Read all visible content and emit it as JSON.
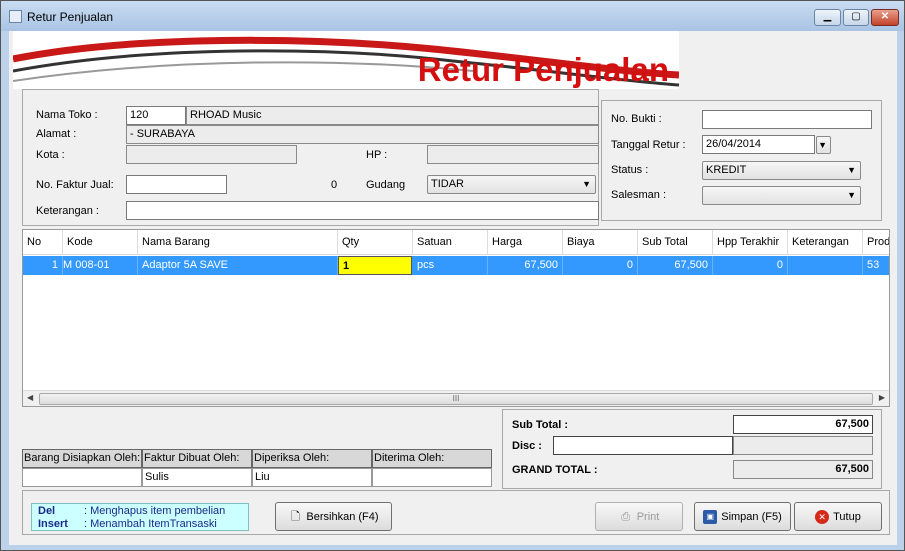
{
  "window": {
    "title": "Retur Penjualan"
  },
  "banner": {
    "title": "Retur Penjualan"
  },
  "form": {
    "nama_toko_label": "Nama Toko :",
    "nama_toko_code": "120",
    "nama_toko_name": "RHOAD Music",
    "alamat_label": "Alamat :",
    "alamat_value": "- SURABAYA",
    "kota_label": "Kota :",
    "kota_value": "",
    "hp_label": "HP :",
    "hp_value": "",
    "no_faktur_label": "No. Faktur Jual:",
    "no_faktur_value": "",
    "count_value": "0",
    "gudang_label": "Gudang",
    "gudang_value": "TIDAR",
    "keterangan_label": "Keterangan :",
    "keterangan_value": ""
  },
  "right_form": {
    "no_bukti_label": "No. Bukti :",
    "no_bukti_value": "",
    "tanggal_label": "Tanggal Retur :",
    "tanggal_value": "26/04/2014",
    "status_label": "Status :",
    "status_value": "KREDIT",
    "salesman_label": "Salesman :",
    "salesman_value": ""
  },
  "grid": {
    "columns": [
      "No",
      "Kode",
      "Nama Barang",
      "Qty",
      "Satuan",
      "Harga",
      "Biaya",
      "Sub Total",
      "Hpp Terakhir",
      "Keterangan",
      "Produ"
    ],
    "rows": [
      {
        "no": "1",
        "kode": "M 008-01",
        "nama": "Adaptor 5A SAVE",
        "qty": "1",
        "satuan": "pcs",
        "harga": "67,500",
        "biaya": "0",
        "subtotal": "67,500",
        "hpp": "0",
        "keterangan": "",
        "produ": "53"
      }
    ]
  },
  "signatures": {
    "headers": [
      "Barang Disiapkan Oleh:",
      "Faktur Dibuat Oleh:",
      "Diperiksa Oleh:",
      "Diterima Oleh:"
    ],
    "values": [
      "",
      "Sulis",
      "Liu",
      ""
    ]
  },
  "totals": {
    "sub_total_label": "Sub Total :",
    "sub_total_value": "67,500",
    "disc_label": "Disc :",
    "disc_value": "",
    "disc_amount": "",
    "grand_total_label": "GRAND TOTAL :",
    "grand_total_value": "67,500"
  },
  "hint": {
    "del_key": "Del",
    "del_text": ": Menghapus item pembelian",
    "insert_key": "Insert",
    "insert_text": ": Menambah ItemTransaski"
  },
  "buttons": {
    "bersihkan": "Bersihkan (F4)",
    "print": "Print",
    "simpan": "Simpan (F5)",
    "tutup": "Tutup"
  },
  "colors": {
    "selection": "#3399ff",
    "banner_red": "#d40f0f",
    "edit_cell": "#ffff00",
    "hint_bg": "#ccffff"
  }
}
